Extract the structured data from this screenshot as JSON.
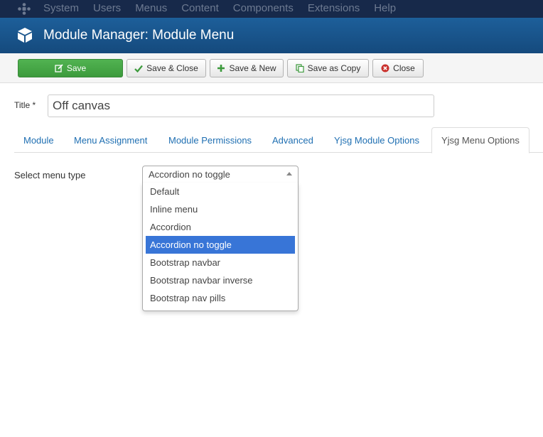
{
  "menubar": {
    "items": [
      "System",
      "Users",
      "Menus",
      "Content",
      "Components",
      "Extensions",
      "Help"
    ]
  },
  "header": {
    "title": "Module Manager: Module Menu"
  },
  "toolbar": {
    "save": "Save",
    "save_close": "Save & Close",
    "save_new": "Save & New",
    "save_copy": "Save as Copy",
    "close": "Close"
  },
  "form": {
    "title_label": "Title *",
    "title_value": "Off canvas"
  },
  "tabs": [
    "Module",
    "Menu Assignment",
    "Module Permissions",
    "Advanced",
    "Yjsg Module Options",
    "Yjsg Menu Options"
  ],
  "active_tab": "Yjsg Menu Options",
  "menu_type": {
    "label": "Select menu type",
    "selected": "Accordion no toggle",
    "options": [
      "Default",
      "Inline menu",
      "Accordion",
      "Accordion no toggle",
      "Bootstrap navbar",
      "Bootstrap navbar inverse",
      "Bootstrap nav pills"
    ]
  },
  "colors": {
    "menubar": "#17294a",
    "header": "#1a5690",
    "save_green": "#46a546",
    "link_blue": "#1f6fb2",
    "highlight": "#3875d7"
  }
}
